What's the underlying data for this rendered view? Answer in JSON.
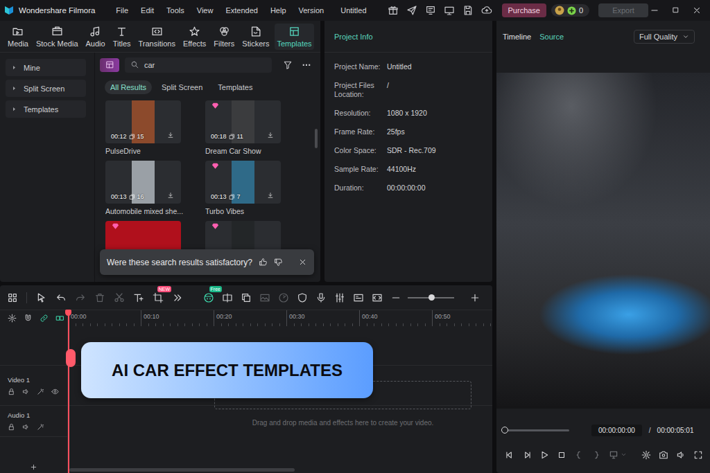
{
  "window": {
    "app_name": "Wondershare Filmora",
    "project_name": "Untitled"
  },
  "menu": [
    "File",
    "Edit",
    "Tools",
    "View",
    "Extended",
    "Help",
    "Version"
  ],
  "purchase_button": "Purchase",
  "credits": "0",
  "export_button": {
    "label": "Export",
    "disabled": true
  },
  "media_tabs": [
    {
      "label": "Media",
      "selected": false
    },
    {
      "label": "Stock Media",
      "selected": false
    },
    {
      "label": "Audio",
      "selected": false
    },
    {
      "label": "Titles",
      "selected": false
    },
    {
      "label": "Transitions",
      "selected": false
    },
    {
      "label": "Effects",
      "selected": false
    },
    {
      "label": "Filters",
      "selected": false
    },
    {
      "label": "Stickers",
      "selected": false
    },
    {
      "label": "Templates",
      "selected": true
    }
  ],
  "sidebar": {
    "items": [
      {
        "label": "Mine",
        "expanded": false
      },
      {
        "label": "Split Screen",
        "expanded": false
      },
      {
        "label": "Templates",
        "expanded": false
      }
    ]
  },
  "search": {
    "value": "car"
  },
  "result_tabs": [
    {
      "label": "All Results",
      "selected": true
    },
    {
      "label": "Split Screen",
      "selected": false
    },
    {
      "label": "Templates",
      "selected": false
    }
  ],
  "templates": [
    {
      "name": "PulseDrive",
      "duration": "00:12",
      "clips": "15",
      "premium": false,
      "kind": "portrait",
      "color": "#8c4a2c"
    },
    {
      "name": "Dream Car Show",
      "duration": "00:18",
      "clips": "11",
      "premium": true,
      "kind": "portrait",
      "color": "#3b3c3e"
    },
    {
      "name": "Automobile mixed she...",
      "duration": "00:13",
      "clips": "16",
      "premium": false,
      "kind": "portrait",
      "color": "#9aa0a6"
    },
    {
      "name": "Turbo Vibes",
      "duration": "00:13",
      "clips": "7",
      "premium": true,
      "kind": "portrait",
      "color": "#2f6a88"
    },
    {
      "premium": true,
      "kind": "landscape",
      "color": "#b0101c"
    },
    {
      "premium": true,
      "kind": "portrait",
      "color": "#232628"
    }
  ],
  "feedback": {
    "text": "Were these search results satisfactory?"
  },
  "project_info": {
    "title": "Project Info",
    "fields": [
      {
        "label": "Project Name:",
        "value": "Untitled"
      },
      {
        "label": "Project Files Location:",
        "value": "/"
      },
      {
        "label": "Resolution:",
        "value": "1080 x 1920"
      },
      {
        "label": "Frame Rate:",
        "value": "25fps"
      },
      {
        "label": "Color Space:",
        "value": "SDR - Rec.709"
      },
      {
        "label": "Sample Rate:",
        "value": "44100Hz"
      },
      {
        "label": "Duration:",
        "value": "00:00:00:00"
      }
    ]
  },
  "timeline": {
    "tools": [
      {
        "disabled": false
      },
      {
        "disabled": false
      },
      {
        "disabled": false
      },
      {
        "disabled": true
      },
      {
        "disabled": true
      },
      {
        "disabled": true
      },
      {
        "disabled": false
      },
      {
        "disabled": false,
        "badge": {
          "text": "NEW",
          "color": "#ff4d7a"
        }
      },
      {
        "disabled": false
      },
      {
        "disabled": false,
        "badge": {
          "text": "Free",
          "color": "#18b888"
        }
      },
      {
        "disabled": false
      },
      {
        "disabled": false
      },
      {
        "disabled": true
      },
      {
        "disabled": true
      },
      {
        "disabled": false
      },
      {
        "disabled": false
      },
      {
        "disabled": false
      },
      {
        "disabled": false
      },
      {
        "disabled": false
      },
      {
        "disabled": false
      },
      {
        "disabled": false
      }
    ],
    "zoom_level": 0.5,
    "ruler": [
      "00:00",
      "00:10",
      "00:20",
      "00:30",
      "00:40",
      "00:50"
    ],
    "tracks": [
      {
        "name": "Video 1",
        "kind": "video"
      },
      {
        "name": "Audio 1",
        "kind": "audio"
      }
    ],
    "drop_hint": "Drag and drop media and effects here to create your video."
  },
  "viewer": {
    "tabs": [
      {
        "label": "Timeline",
        "selected": false
      },
      {
        "label": "Source",
        "selected": true
      }
    ],
    "quality": "Full Quality",
    "current_time": "00:00:00:00",
    "separator": "/",
    "total_time": "00:00:05:01",
    "progress": 0
  },
  "banner": {
    "text": "AI CAR EFFECT TEMPLATES"
  }
}
